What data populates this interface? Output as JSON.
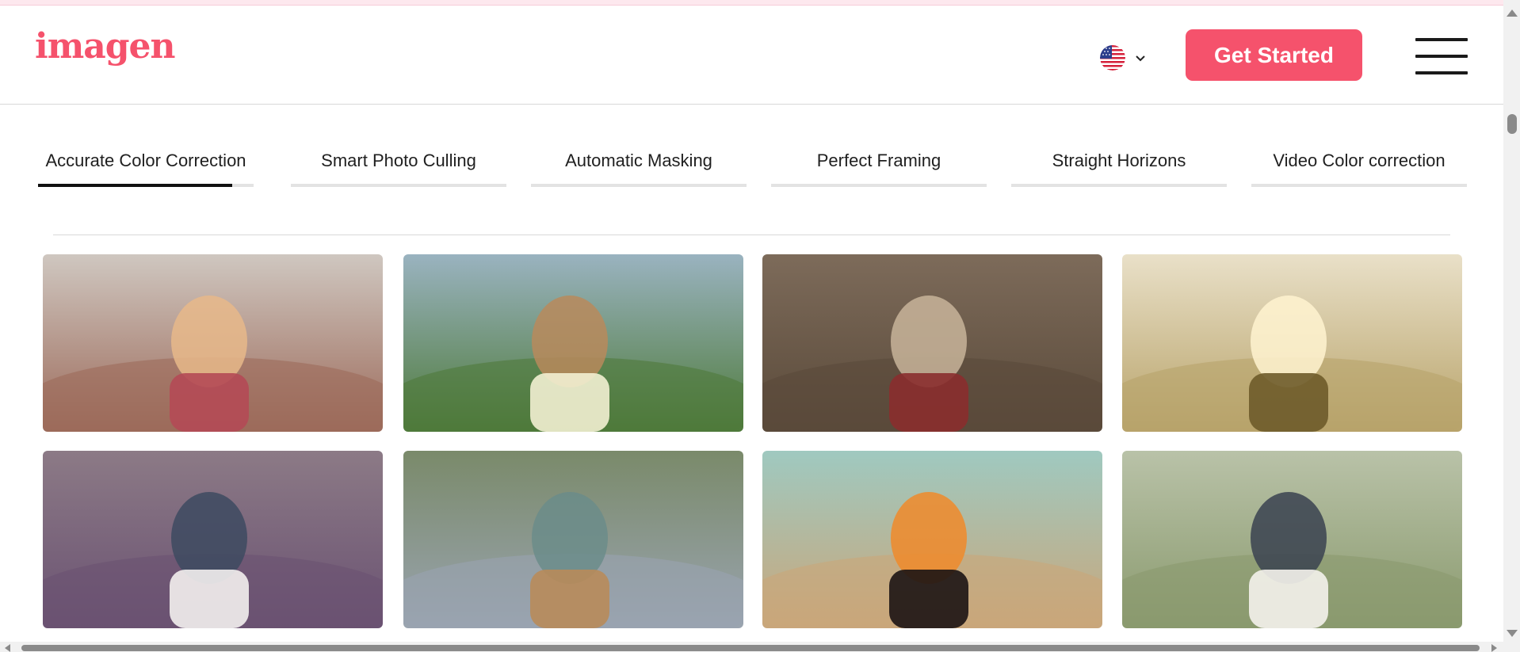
{
  "header": {
    "logo_text": "imagen",
    "brand_color": "#f5526c",
    "language": {
      "flag_icon": "us-flag-icon",
      "chevron_icon": "chevron-down-icon"
    },
    "cta_label": "Get Started",
    "menu_icon": "hamburger-menu-icon"
  },
  "tabs": {
    "active_index": 0,
    "active_progress": 0.9,
    "items": [
      {
        "label": "Accurate Color Correction"
      },
      {
        "label": "Smart Photo Culling"
      },
      {
        "label": "Automatic Masking"
      },
      {
        "label": "Perfect Framing"
      },
      {
        "label": "Straight Horizons"
      },
      {
        "label": "Video Color correction"
      }
    ]
  },
  "gallery": {
    "photos": [
      {
        "name": "photo-woman-smiling-wind"
      },
      {
        "name": "photo-woman-dancing-meadow"
      },
      {
        "name": "photo-couple-forest-walk"
      },
      {
        "name": "photo-surfers-sunset"
      },
      {
        "name": "photo-couple-lavender-field"
      },
      {
        "name": "photo-friends-lake-dock"
      },
      {
        "name": "photo-woman-sunglasses-lying"
      },
      {
        "name": "photo-wedding-couple-field"
      }
    ]
  }
}
